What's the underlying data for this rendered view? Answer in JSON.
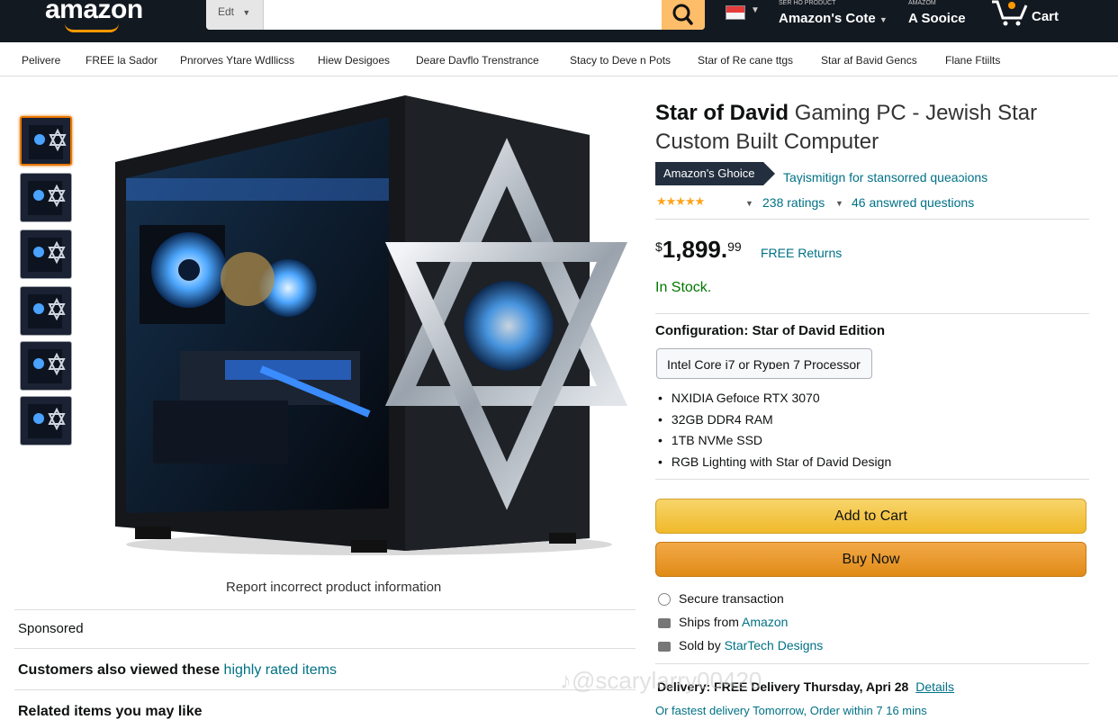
{
  "header": {
    "logo": "amazon",
    "search_category": "Edt",
    "search_placeholder": "",
    "account1_small": "SER HO PRODUCT",
    "account1_big": "Amazon's Cote",
    "account2_small": "AMAZOM",
    "account2_big": "A Sooice",
    "cart_label": "Cart"
  },
  "nav": {
    "items": [
      "Pelivere",
      "FREE la Sador",
      "Pnrorves Ytare Wdllicss",
      "Hiew Desigoes",
      "Deare Davflo Trenstrance",
      "Stacy to Deve n Pots",
      "Star of Re cane ttgs",
      "Star af Bavid Gencs",
      "Flane Ftiilts"
    ]
  },
  "gallery": {
    "report_text": "Report incorrect product information"
  },
  "left_sections": {
    "sponsored": "Sponsored",
    "also_viewed_prefix": "Customers also viewed these",
    "also_viewed_link": "highly rated items",
    "related": "Related items you may like"
  },
  "product": {
    "title_bold": "Star of David",
    "title_rest": " Gaming PC - Jewish Star Custom Built Computer",
    "badge": "Amazon's Ghoice",
    "badge_desc": "Taγismitign for stansorred queaɔions",
    "stars": "★★★★★",
    "ratings": "238 ratings",
    "answered": "46 answred questions",
    "price_symbol": "$",
    "price_whole": "1,899.",
    "price_fraction": "99",
    "free_returns": "FREE Returns",
    "stock": "In Stock.",
    "config_label": "Configuration: Star of David Edition",
    "config_option": "Intel Core i7 or Ryɒen 7 Processor",
    "features": [
      "NXIDIA Gefoιce RTX 3070",
      "32GB DDR4 RAM",
      "1TB NVMe SSD",
      "RGB Lighting with Star of David Design"
    ],
    "add_to_cart": "Add to Cart",
    "buy_now": "Buy Now",
    "secure": "Secure transaction",
    "ships_prefix": "Ships from",
    "ships_from": "Amazon",
    "sold_prefix": "Sold by",
    "sold_by": "StarTech Designs",
    "delivery_prefix": "Delivery: FREE Delivery Thursday, Apri",
    "delivery_day": "28",
    "details": "Details",
    "fastest": "Or fastest delivery Tomorrow, Order within 7 16 mins"
  },
  "watermark": "♪@scarylarry00420",
  "colors": {
    "header_bg": "#131921",
    "accent": "#ff9900",
    "link": "#007185",
    "stock": "#007600",
    "add_to_cart": "#f0b92a",
    "buy_now": "#e08b17"
  }
}
